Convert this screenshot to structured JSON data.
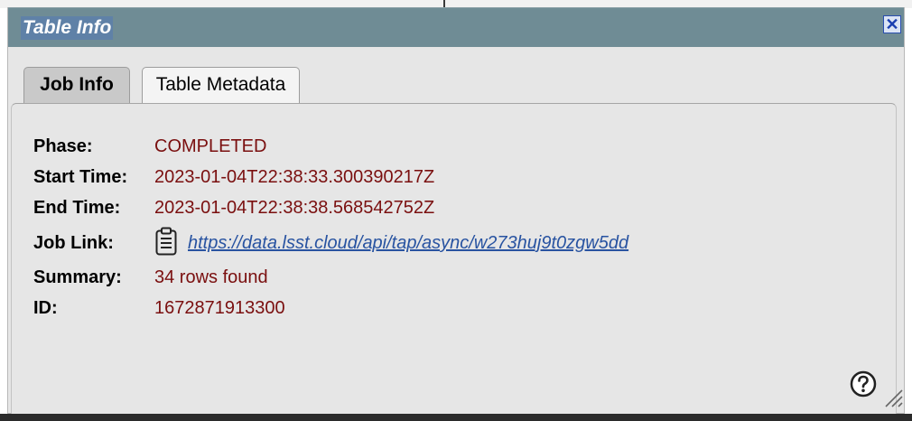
{
  "dialog": {
    "title": "Table Info",
    "close_glyph": "✕",
    "tabs": [
      {
        "label": "Job Info",
        "selected": true
      },
      {
        "label": "Table Metadata",
        "selected": false
      }
    ]
  },
  "job_info": {
    "phase_label": "Phase:",
    "phase_value": "COMPLETED",
    "start_label": "Start Time:",
    "start_value": "2023-01-04T22:38:33.300390217Z",
    "end_label": "End Time:",
    "end_value": "2023-01-04T22:38:38.568542752Z",
    "link_label": "Job Link:",
    "link_url": "https://data.lsst.cloud/api/tap/async/w273huj9t0zgw5dd",
    "summary_label": "Summary:",
    "summary_value": "34 rows found",
    "id_label": "ID:",
    "id_value": "1672871913300"
  },
  "icons": {
    "close": "close-icon",
    "clipboard": "clipboard-icon",
    "help": "help-icon",
    "resize": "resize-grip-icon"
  },
  "colors": {
    "titlebar": "#6f8c95",
    "title_highlight": "#5f81a7",
    "value_text": "#7a0f0f",
    "link_text": "#2853a1",
    "panel_bg": "#e6e6e6"
  }
}
